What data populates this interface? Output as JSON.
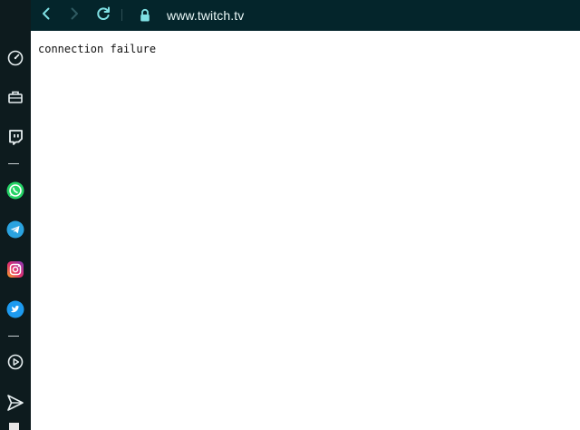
{
  "browser": {
    "address_bar": {
      "url": "www.twitch.tv"
    },
    "nav": {
      "back_icon": "chevron-left-icon",
      "forward_icon": "chevron-right-icon",
      "reload_icon": "reload-icon",
      "secure_icon": "lock-icon"
    }
  },
  "sidebar": {
    "items": [
      {
        "icon": "speed-dial-icon"
      },
      {
        "icon": "workspace-icon"
      },
      {
        "icon": "twitch-icon"
      },
      {
        "icon": "whatsapp-icon"
      },
      {
        "icon": "telegram-icon"
      },
      {
        "icon": "instagram-icon"
      },
      {
        "icon": "twitter-icon"
      },
      {
        "icon": "player-icon"
      },
      {
        "icon": "send-icon"
      }
    ]
  },
  "page": {
    "message": "connection failure"
  },
  "colors": {
    "sidebar_bg": "#0d1b1e",
    "topbar_bg": "#04252b",
    "accent_teal": "#7fe0e4",
    "whatsapp": "#25d366",
    "telegram": "#2aa3e0",
    "twitter": "#1d9bf0"
  }
}
